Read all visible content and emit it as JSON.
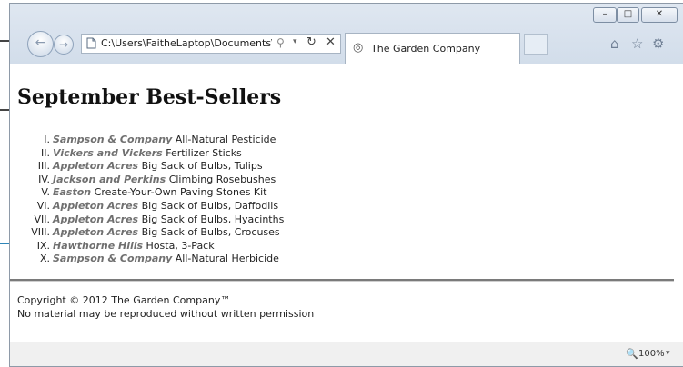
{
  "window": {
    "min_glyph": "–",
    "max_glyph": "□",
    "close_glyph": "✕"
  },
  "nav": {
    "back_glyph": "←",
    "forward_glyph": "→"
  },
  "address": {
    "url": "C:\\Users\\FaitheLaptop\\Documents\\N",
    "search_glyph": "⚲",
    "dropdown_glyph": "▾",
    "refresh_glyph": "↻",
    "stop_glyph": "✕"
  },
  "tab": {
    "title": "The Garden Company",
    "icon_glyph": "◎"
  },
  "toolbar": {
    "home_glyph": "⌂",
    "star_glyph": "☆",
    "gear_glyph": "⚙"
  },
  "page": {
    "title": "September Best-Sellers",
    "items": [
      {
        "num": "I.",
        "brand": "Sampson & Company",
        "product": " All-Natural Pesticide"
      },
      {
        "num": "II.",
        "brand": "Vickers and Vickers",
        "product": " Fertilizer Sticks"
      },
      {
        "num": "III.",
        "brand": "Appleton Acres",
        "product": " Big Sack of Bulbs, Tulips"
      },
      {
        "num": "IV.",
        "brand": "Jackson and Perkins",
        "product": " Climbing Rosebushes"
      },
      {
        "num": "V.",
        "brand": "Easton",
        "product": " Create-Your-Own Paving Stones Kit"
      },
      {
        "num": "VI.",
        "brand": "Appleton Acres",
        "product": " Big Sack of Bulbs, Daffodils"
      },
      {
        "num": "VII.",
        "brand": "Appleton Acres",
        "product": " Big Sack of Bulbs, Hyacinths"
      },
      {
        "num": "VIII.",
        "brand": "Appleton Acres",
        "product": " Big Sack of Bulbs, Crocuses"
      },
      {
        "num": "IX.",
        "brand": "Hawthorne Hills",
        "product": " Hosta, 3-Pack"
      },
      {
        "num": "X.",
        "brand": "Sampson & Company",
        "product": " All-Natural Herbicide"
      }
    ],
    "footer_line1": "Copyright © 2012 The Garden Company™",
    "footer_line2": "No material may be reproduced without written permission"
  },
  "status": {
    "zoom_glyph": "🔍",
    "zoom_level": "100%",
    "dropdown_glyph": "▾"
  }
}
